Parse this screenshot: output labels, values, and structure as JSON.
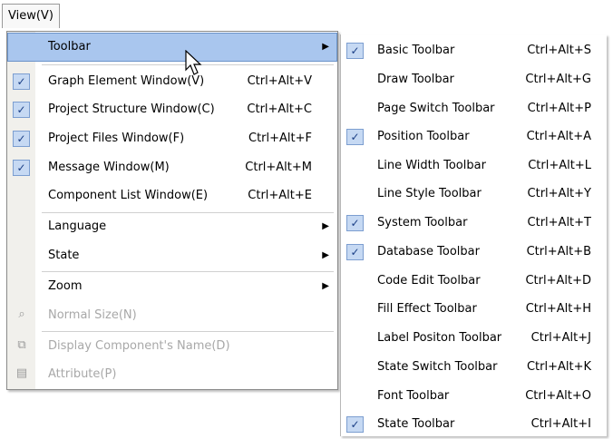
{
  "menubar": {
    "view_label": "View(V)"
  },
  "view_menu": {
    "items": [
      {
        "label": "Toolbar",
        "shortcut": "",
        "checked": false,
        "submenu": true,
        "disabled": false,
        "selected": true
      },
      {
        "label": "Graph Element Window(V)",
        "shortcut": "Ctrl+Alt+V",
        "checked": true,
        "submenu": false,
        "disabled": false
      },
      {
        "label": "Project Structure Window(C)",
        "shortcut": "Ctrl+Alt+C",
        "checked": true,
        "submenu": false,
        "disabled": false
      },
      {
        "label": "Project Files Window(F)",
        "shortcut": "Ctrl+Alt+F",
        "checked": true,
        "submenu": false,
        "disabled": false
      },
      {
        "label": "Message Window(M)",
        "shortcut": "Ctrl+Alt+M",
        "checked": true,
        "submenu": false,
        "disabled": false
      },
      {
        "label": "Component List Window(E)",
        "shortcut": "Ctrl+Alt+E",
        "checked": false,
        "submenu": false,
        "disabled": false
      },
      {
        "label": "Language",
        "shortcut": "",
        "checked": false,
        "submenu": true,
        "disabled": false
      },
      {
        "label": "State",
        "shortcut": "",
        "checked": false,
        "submenu": true,
        "disabled": false
      },
      {
        "label": "Zoom",
        "shortcut": "",
        "checked": false,
        "submenu": true,
        "disabled": false
      },
      {
        "label": "Normal Size(N)",
        "shortcut": "",
        "checked": false,
        "submenu": false,
        "disabled": true,
        "icon": "zoom-icon"
      },
      {
        "label": "Display Component's Name(D)",
        "shortcut": "",
        "checked": false,
        "submenu": false,
        "disabled": true,
        "icon": "component-name-icon"
      },
      {
        "label": "Attribute(P)",
        "shortcut": "",
        "checked": false,
        "submenu": false,
        "disabled": true,
        "icon": "attribute-icon"
      }
    ]
  },
  "toolbar_submenu": {
    "items": [
      {
        "label": "Basic Toolbar",
        "shortcut": "Ctrl+Alt+S",
        "checked": true
      },
      {
        "label": "Draw Toolbar",
        "shortcut": "Ctrl+Alt+G",
        "checked": false
      },
      {
        "label": "Page Switch Toolbar",
        "shortcut": "Ctrl+Alt+P",
        "checked": false
      },
      {
        "label": "Position Toolbar",
        "shortcut": "Ctrl+Alt+A",
        "checked": true
      },
      {
        "label": "Line Width Toolbar",
        "shortcut": "Ctrl+Alt+L",
        "checked": false
      },
      {
        "label": "Line Style Toolbar",
        "shortcut": "Ctrl+Alt+Y",
        "checked": false
      },
      {
        "label": "System Toolbar",
        "shortcut": "Ctrl+Alt+T",
        "checked": true
      },
      {
        "label": "Database Toolbar",
        "shortcut": "Ctrl+Alt+B",
        "checked": true
      },
      {
        "label": "Code Edit Toolbar",
        "shortcut": "Ctrl+Alt+D",
        "checked": false
      },
      {
        "label": "Fill Effect Toolbar",
        "shortcut": "Ctrl+Alt+H",
        "checked": false
      },
      {
        "label": "Label Positon Toolbar",
        "shortcut": "Ctrl+Alt+J",
        "checked": false
      },
      {
        "label": "State Switch Toolbar",
        "shortcut": "Ctrl+Alt+K",
        "checked": false
      },
      {
        "label": "Font Toolbar",
        "shortcut": "Ctrl+Alt+O",
        "checked": false
      },
      {
        "label": "State Toolbar",
        "shortcut": "Ctrl+Alt+I",
        "checked": true
      }
    ]
  },
  "colors": {
    "highlight": "#a9c6ee",
    "check_bg": "#c6d9f3",
    "disabled_text": "#a8a8a8"
  }
}
